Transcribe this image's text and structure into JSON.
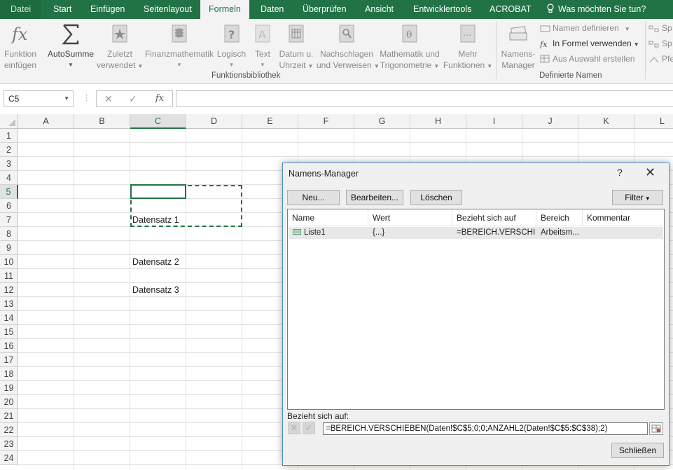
{
  "ribbon_tabs": [
    {
      "label": "Datei"
    },
    {
      "label": "Start"
    },
    {
      "label": "Einfügen"
    },
    {
      "label": "Seitenlayout"
    },
    {
      "label": "Formeln"
    },
    {
      "label": "Daten"
    },
    {
      "label": "Überprüfen"
    },
    {
      "label": "Ansicht"
    },
    {
      "label": "Entwicklertools"
    },
    {
      "label": "ACROBAT"
    },
    {
      "label": "Was möchten Sie tun?"
    }
  ],
  "ribbon": {
    "funktion_einfuegen": {
      "line1": "Funktion",
      "line2": "einfügen"
    },
    "autosumme": {
      "line1": "AutoSumme"
    },
    "zuletzt": {
      "line1": "Zuletzt",
      "line2": "verwendet"
    },
    "finanz": {
      "line1": "Finanzmathematik"
    },
    "logisch": {
      "line1": "Logisch"
    },
    "text": {
      "line1": "Text"
    },
    "datum": {
      "line1": "Datum u.",
      "line2": "Uhrzeit"
    },
    "nachschlagen": {
      "line1": "Nachschlagen",
      "line2": "und Verweisen"
    },
    "mathematik": {
      "line1": "Mathematik und",
      "line2": "Trigonometrie"
    },
    "mehr": {
      "line1": "Mehr",
      "line2": "Funktionen"
    },
    "group_funktionsbibliothek": "Funktionsbibliothek",
    "namens_manager": {
      "line1": "Namens-",
      "line2": "Manager"
    },
    "namen_definieren": "Namen definieren",
    "in_formel": "In Formel verwenden",
    "aus_auswahl": "Aus Auswahl erstellen",
    "group_definierte_namen": "Definierte Namen",
    "cut_sp1": "Sp",
    "cut_sp2": "Sp",
    "cut_pfe": "Pfe"
  },
  "formula_bar": {
    "name_box": "C5",
    "fx_label": "fx",
    "content": ""
  },
  "sheet": {
    "columns": [
      "A",
      "B",
      "C",
      "D",
      "E",
      "F",
      "G",
      "H",
      "I",
      "J",
      "K",
      "L"
    ],
    "rows": [
      "1",
      "2",
      "3",
      "4",
      "5",
      "6",
      "7",
      "8",
      "9",
      "10",
      "11",
      "12",
      "13",
      "14",
      "15",
      "16",
      "17",
      "18",
      "19",
      "20",
      "21",
      "22",
      "23",
      "24"
    ],
    "selected_column": "C",
    "selected_row": "5",
    "cells": {
      "C7": "Datensatz 1",
      "C10": "Datensatz 2",
      "C12": "Datensatz 3"
    }
  },
  "dialog": {
    "title": "Namens-Manager",
    "help": "?",
    "close": "✕",
    "buttons": {
      "neu": "Neu...",
      "bearbeiten": "Bearbeiten...",
      "loeschen": "Löschen",
      "filter": "Filter"
    },
    "columns": [
      "Name",
      "Wert",
      "Bezieht sich auf",
      "Bereich",
      "Kommentar"
    ],
    "rows": [
      {
        "name": "Liste1",
        "wert": "{...}",
        "bezieht": "=BEREICH.VERSCHI...",
        "bereich": "Arbeitsm...",
        "kommentar": ""
      }
    ],
    "refers_label": "Bezieht sich auf:",
    "refers_value": "=BEREICH.VERSCHIEBEN(Daten!$C$5;0;0;ANZAHL2(Daten!$C$5:$C$38);2)",
    "schliessen": "Schließen"
  },
  "colors": {
    "accent": "#217346",
    "dialog_border": "#4a8fd1"
  }
}
